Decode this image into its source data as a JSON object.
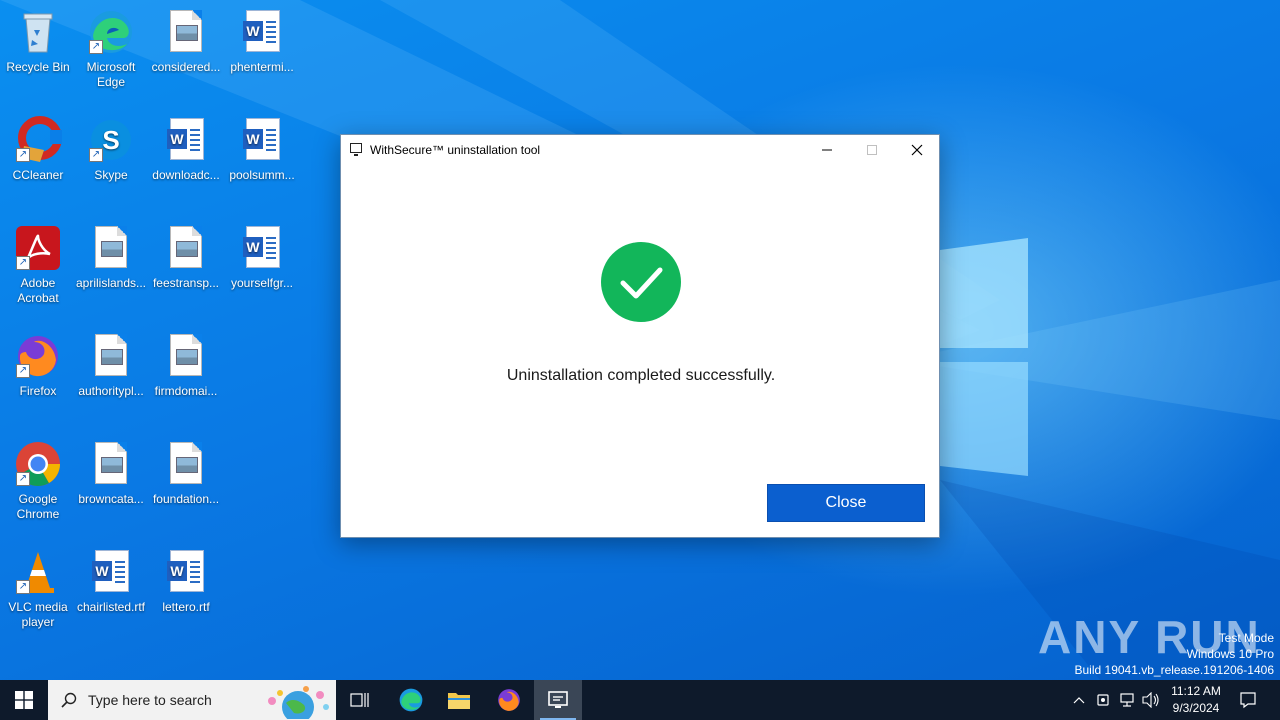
{
  "desktop": {
    "icons": [
      {
        "label": "Recycle Bin"
      },
      {
        "label": "Microsoft Edge"
      },
      {
        "label": "considered..."
      },
      {
        "label": "phentermi..."
      },
      {
        "label": "CCleaner"
      },
      {
        "label": "Skype"
      },
      {
        "label": "downloadc..."
      },
      {
        "label": "poolsumm..."
      },
      {
        "label": "Adobe Acrobat"
      },
      {
        "label": "aprilislands..."
      },
      {
        "label": "feestransp..."
      },
      {
        "label": "yourselfgr..."
      },
      {
        "label": "Firefox"
      },
      {
        "label": "authoritypl..."
      },
      {
        "label": "firmdomai..."
      },
      {
        "label": "Google Chrome"
      },
      {
        "label": "browncata..."
      },
      {
        "label": "foundation..."
      },
      {
        "label": "VLC media player"
      },
      {
        "label": "chairlisted.rtf"
      },
      {
        "label": "lettero.rtf"
      }
    ]
  },
  "dialog": {
    "title": "WithSecure™ uninstallation tool",
    "message": "Uninstallation completed successfully.",
    "close_button": "Close",
    "success_color": "#12b65a",
    "accent_color": "#0b5fcf"
  },
  "watermark": {
    "brand": "ANY RUN",
    "line1": "Test Mode",
    "line2": "Windows 10 Pro",
    "line3": "Build 19041.vb_release.191206-1406"
  },
  "taskbar": {
    "search_placeholder": "Type here to search",
    "time": "11:12 AM",
    "date": "9/3/2024"
  }
}
